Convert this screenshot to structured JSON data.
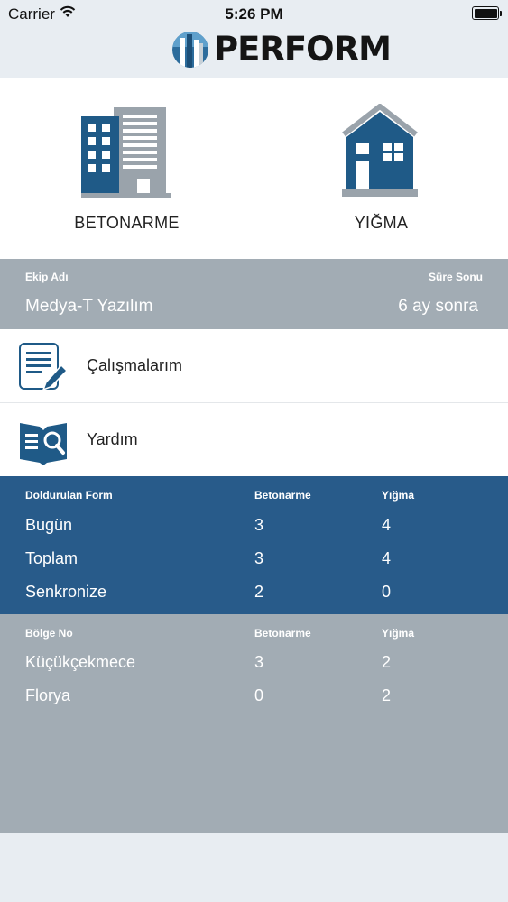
{
  "status_bar": {
    "carrier": "Carrier",
    "time": "5:26 PM",
    "wifi_icon": "wifi-icon",
    "battery_icon": "battery-icon"
  },
  "header": {
    "logo_text": "PERFORM",
    "logo_icon": "building-logo-icon"
  },
  "tiles": [
    {
      "label": "BETONARME",
      "icon": "apartment-buildings-icon"
    },
    {
      "label": "YIĞMA",
      "icon": "house-icon"
    }
  ],
  "team": {
    "name_header": "Ekip Adı",
    "name_value": "Medya-T Yazılım",
    "expiry_header": "Süre Sonu",
    "expiry_value": "6 ay sonra"
  },
  "menu": [
    {
      "label": "Çalışmalarım",
      "icon": "document-edit-icon"
    },
    {
      "label": "Yardım",
      "icon": "help-search-icon"
    }
  ],
  "forms_table": {
    "headers": [
      "Doldurulan Form",
      "Betonarme",
      "Yığma"
    ],
    "rows": [
      [
        "Bugün",
        "3",
        "4"
      ],
      [
        "Toplam",
        "3",
        "4"
      ],
      [
        "Senkronize",
        "2",
        "0"
      ]
    ]
  },
  "regions_table": {
    "headers": [
      "Bölge No",
      "Betonarme",
      "Yığma"
    ],
    "rows": [
      [
        "Küçükçekmece",
        "3",
        "2"
      ],
      [
        "Florya",
        "0",
        "2"
      ]
    ]
  },
  "colors": {
    "primary_blue": "#285b8a",
    "gray_panel": "#a2acb4",
    "icon_blue": "#1f5a87",
    "icon_gray": "#9aa3ab",
    "background": "#e8edf2"
  }
}
